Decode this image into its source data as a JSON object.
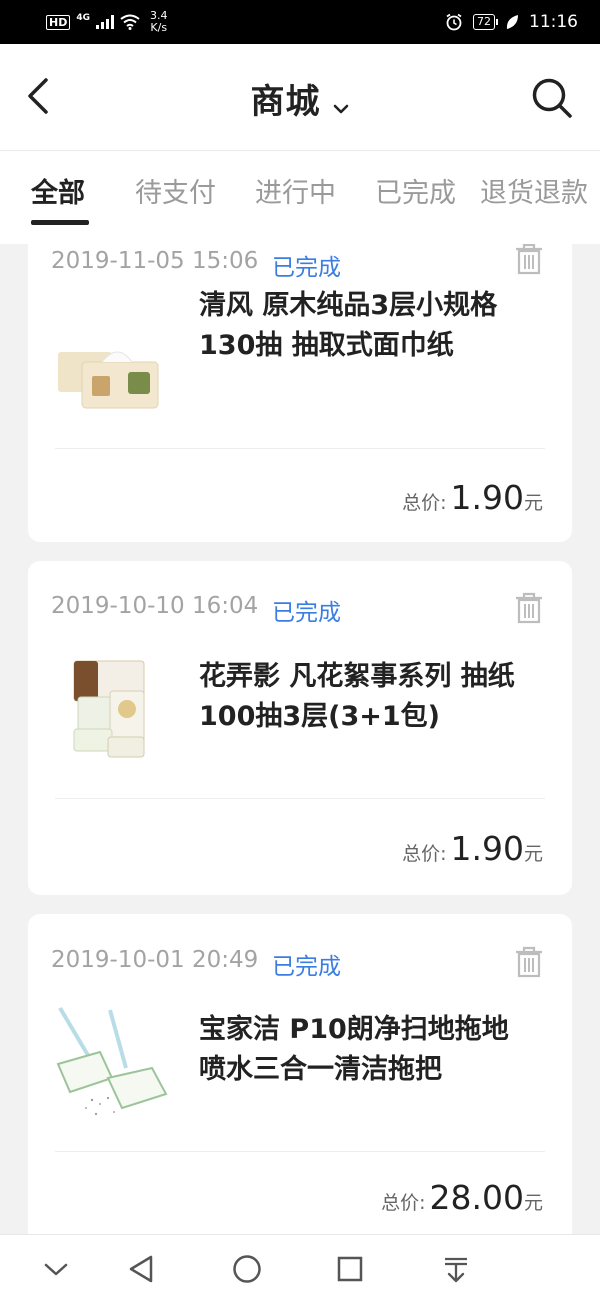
{
  "status_bar": {
    "hd": "HD",
    "network": "4G",
    "speed_value": "3.4",
    "speed_unit": "K/s",
    "battery": "72",
    "time": "11:16"
  },
  "header": {
    "title": "商城"
  },
  "tabs": [
    {
      "label": "全部",
      "active": true
    },
    {
      "label": "待支付",
      "active": false
    },
    {
      "label": "进行中",
      "active": false
    },
    {
      "label": "已完成",
      "active": false
    },
    {
      "label": "退货退款",
      "active": false
    }
  ],
  "orders": [
    {
      "datetime": "2019-11-05 15:06",
      "status": "已完成",
      "name_line1": "清风 原木纯品3层小规格",
      "name_line2": "130抽 抽取式面巾纸",
      "total_label": "总价:",
      "total_amount": "1.90",
      "currency": "元"
    },
    {
      "datetime": "2019-10-10 16:04",
      "status": "已完成",
      "name_line1": "花弄影 凡花絮事系列 抽纸",
      "name_line2": "100抽3层(3+1包)",
      "total_label": "总价:",
      "total_amount": "1.90",
      "currency": "元"
    },
    {
      "datetime": "2019-10-01 20:49",
      "status": "已完成",
      "name_line1": "宝家洁 P10朗净扫地拖地",
      "name_line2": "喷水三合一清洁拖把",
      "total_label": "总价:",
      "total_amount": "28.00",
      "currency": "元"
    }
  ],
  "colors": {
    "accent_blue": "#3b7de0",
    "page_bg": "#f2f2f2",
    "muted_text": "#a3a3a3"
  },
  "icons": {
    "back": "chevron-left-icon",
    "title_dropdown": "chevron-down-icon",
    "search": "search-icon",
    "delete": "trash-icon",
    "nav_collapse": "chevron-down-icon",
    "nav_back": "triangle-back-icon",
    "nav_home": "circle-home-icon",
    "nav_recents": "square-recents-icon",
    "nav_notifications": "pull-down-icon"
  }
}
